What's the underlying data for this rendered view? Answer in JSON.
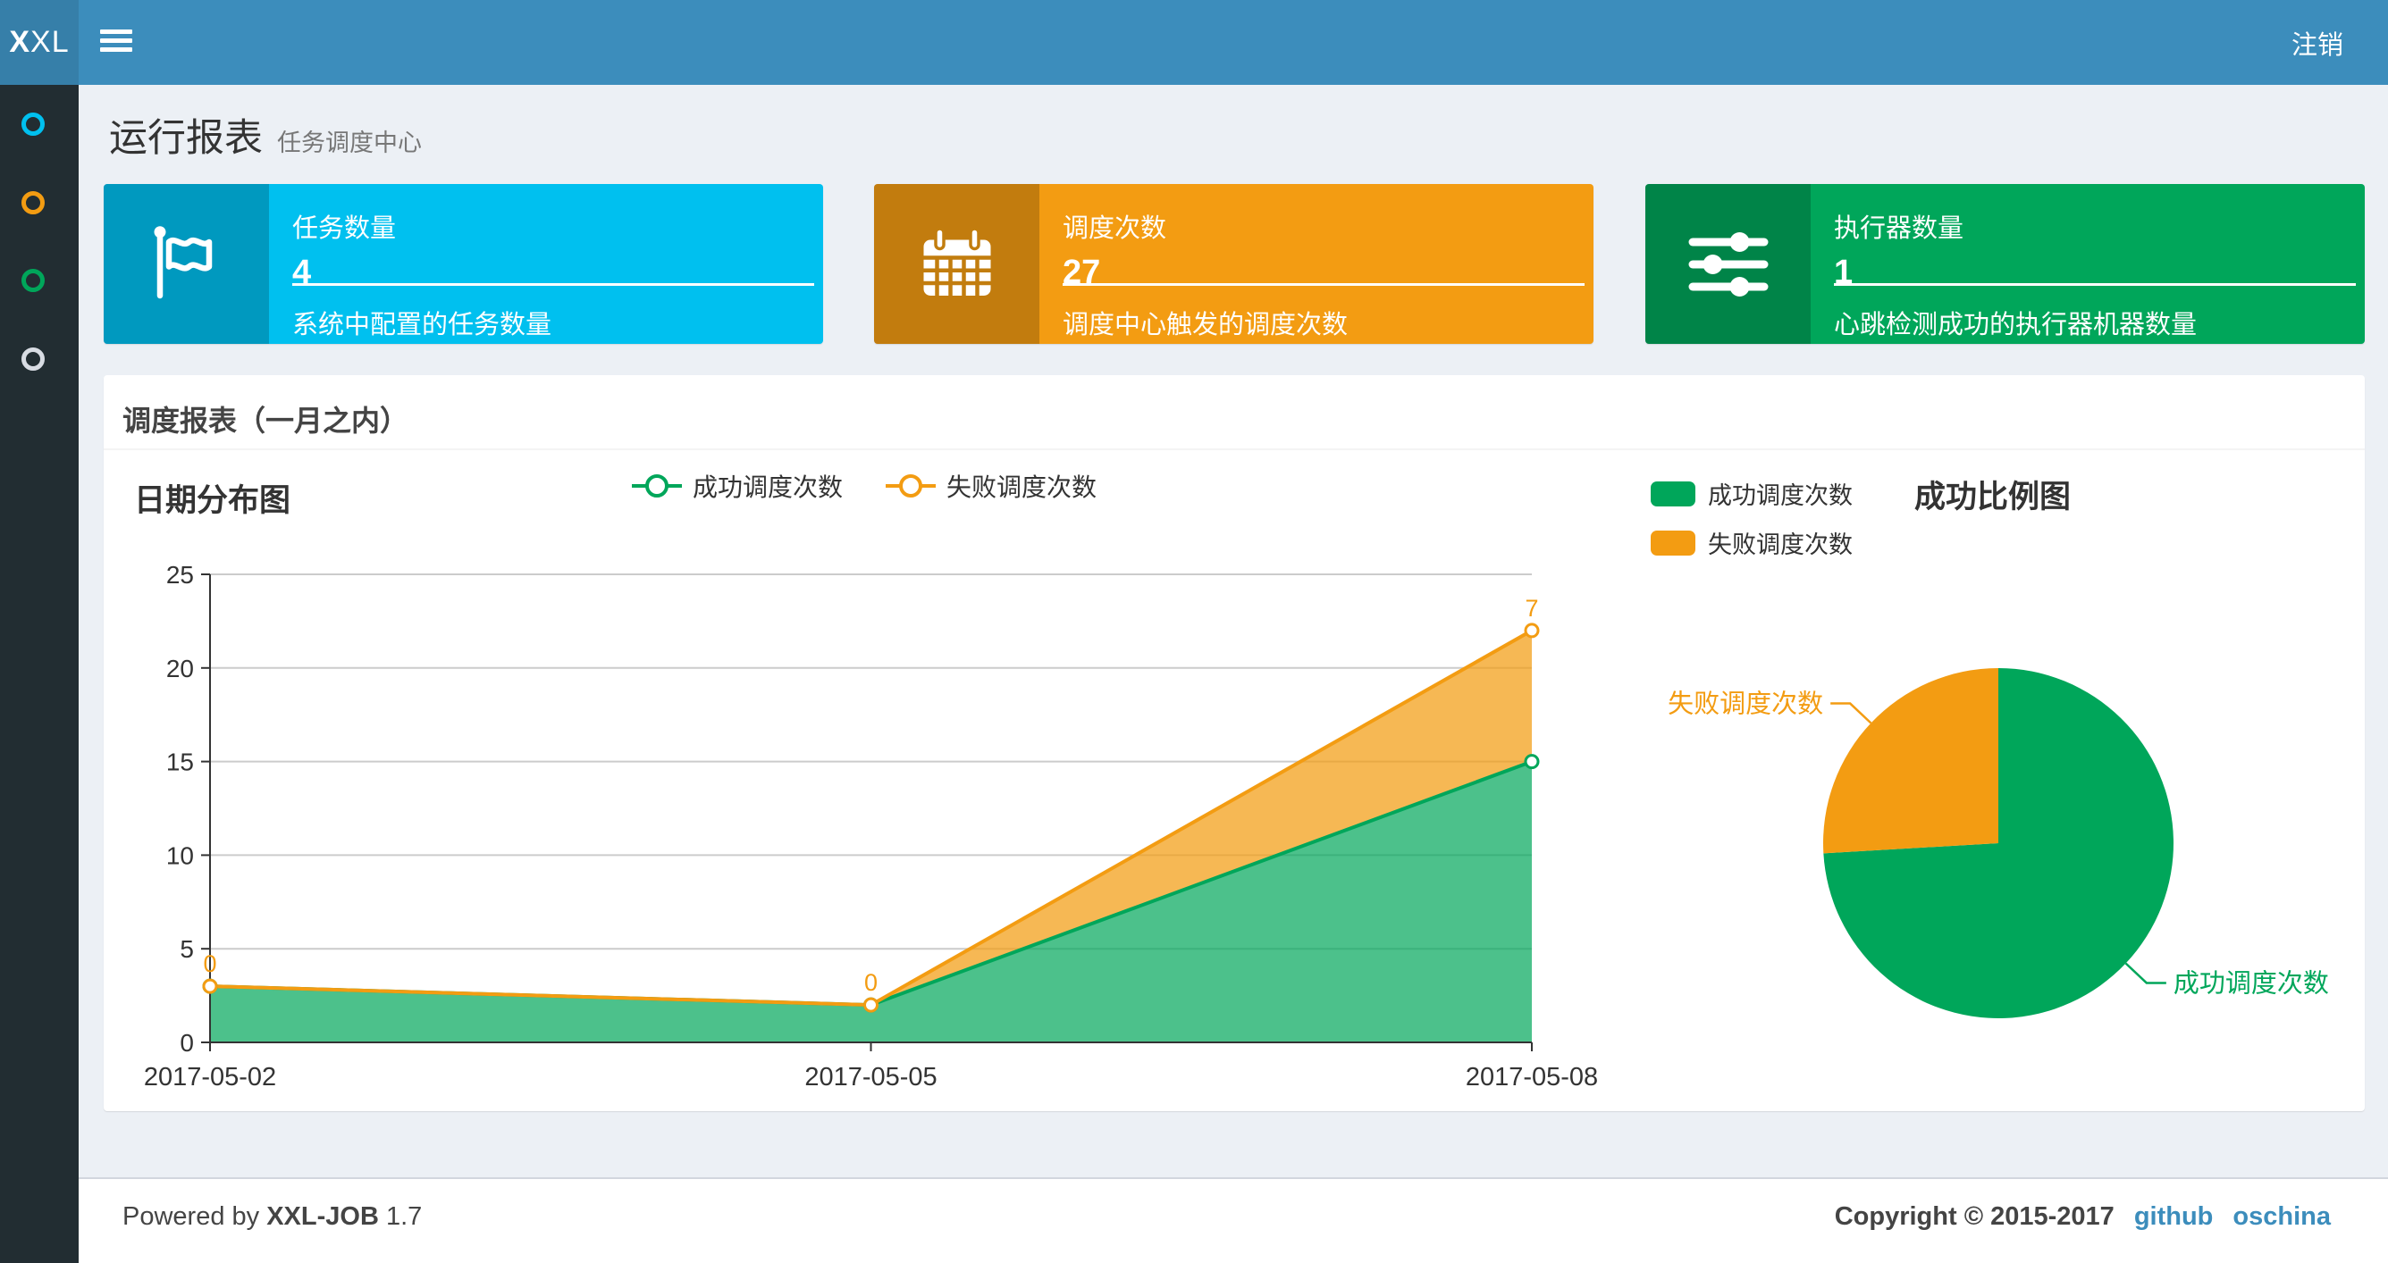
{
  "navbar": {
    "logo_bold": "X",
    "logo_rest": "XL",
    "logout_label": "注销"
  },
  "sidebar": {
    "items": [
      {
        "name": "menu-report",
        "circle_color": "#00c0ef"
      },
      {
        "name": "menu-job",
        "circle_color": "#f39c12"
      },
      {
        "name": "menu-log",
        "circle_color": "#00a65a"
      },
      {
        "name": "menu-help",
        "circle_color": "#d8dce3"
      }
    ]
  },
  "page_header": {
    "title": "运行报表",
    "subtitle": "任务调度中心"
  },
  "info_boxes": [
    {
      "label": "任务数量",
      "value": "4",
      "desc": "系统中配置的任务数量",
      "color": "#00c0ef",
      "icon": "flag-icon"
    },
    {
      "label": "调度次数",
      "value": "27",
      "desc": "调度中心触发的调度次数",
      "color": "#f39c12",
      "icon": "calendar-icon"
    },
    {
      "label": "执行器数量",
      "value": "1",
      "desc": "心跳检测成功的执行器机器数量",
      "color": "#00a65a",
      "icon": "sliders-icon"
    }
  ],
  "panel": {
    "title": "调度报表（一月之内）"
  },
  "chart_data": [
    {
      "type": "area",
      "title": "日期分布图",
      "x": [
        "2017-05-02",
        "2017-05-05",
        "2017-05-08"
      ],
      "stacked": true,
      "series": [
        {
          "name": "成功调度次数",
          "color": "#00a65a",
          "fill": "rgba(0,166,90,0.7)",
          "values": [
            3,
            2,
            15
          ]
        },
        {
          "name": "失败调度次数",
          "color": "#f39c12",
          "fill": "rgba(243,156,18,0.72)",
          "values": [
            0,
            0,
            7
          ],
          "point_labels": true
        }
      ],
      "ylim": [
        0,
        25
      ],
      "yticks": [
        0,
        5,
        10,
        15,
        20,
        25
      ],
      "grid": true,
      "legend_position": "top-center"
    },
    {
      "type": "pie",
      "title": "成功比例图",
      "slices": [
        {
          "name": "成功调度次数",
          "value": 20,
          "color": "#00a65a"
        },
        {
          "name": "失败调度次数",
          "value": 7,
          "color": "#f39c12"
        }
      ],
      "legend_position": "top-left"
    }
  ],
  "footer": {
    "powered_prefix": "Powered by",
    "product": "XXL-JOB",
    "version": "1.7",
    "copyright": "Copyright © 2015-2017",
    "links": [
      "github",
      "oschina"
    ]
  }
}
